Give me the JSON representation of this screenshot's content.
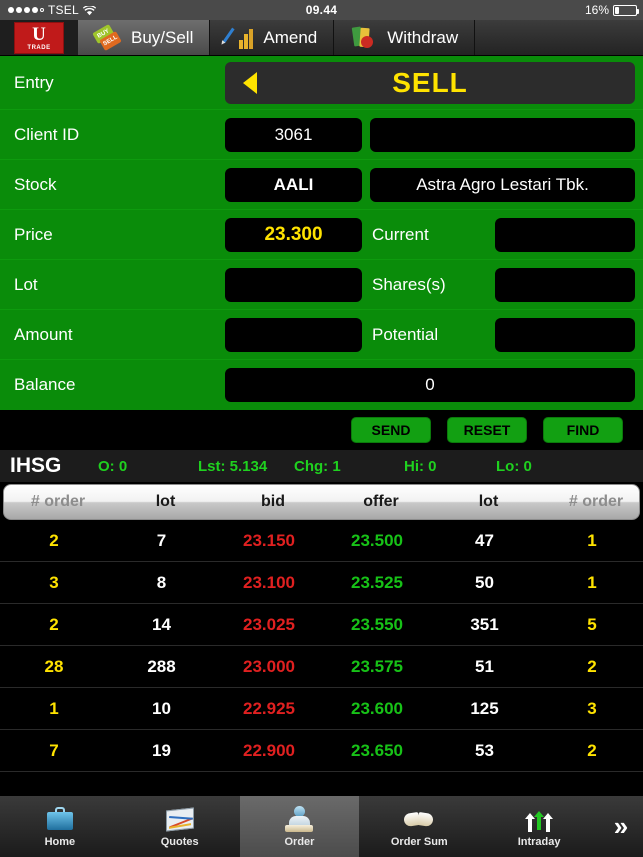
{
  "status_bar": {
    "carrier": "TSEL",
    "signal_dots_filled": 4,
    "signal_dots_total": 5,
    "wifi_icon": "wifi-icon",
    "time": "09.44",
    "battery_percent": "16%",
    "battery_level": 16
  },
  "brand": {
    "logo_letter": "U",
    "logo_word": "TRADE"
  },
  "top_tabs": [
    {
      "label": "Buy/Sell",
      "icon": "buy-sell-tags-icon",
      "active": true
    },
    {
      "label": "Amend",
      "icon": "amend-chart-pencil-icon",
      "active": false
    },
    {
      "label": "Withdraw",
      "icon": "withdraw-books-icon",
      "active": false
    }
  ],
  "entry_form": {
    "entry": {
      "label": "Entry",
      "arrow_icon": "caret-left-icon",
      "value": "SELL",
      "value_color": "#ffe300"
    },
    "client_id": {
      "label": "Client ID",
      "value": "3061",
      "secondary_value": ""
    },
    "stock": {
      "label": "Stock",
      "code": "AALI",
      "name": "Astra Agro Lestari Tbk."
    },
    "price": {
      "label": "Price",
      "value": "23.300",
      "value_color": "#ffe300",
      "current_label": "Current",
      "current_value": ""
    },
    "lot": {
      "label": "Lot",
      "value": "",
      "shares_label": "Shares(s)",
      "shares_value": ""
    },
    "amount": {
      "label": "Amount",
      "value": "",
      "potential_label": "Potential",
      "potential_value": ""
    },
    "balance": {
      "label": "Balance",
      "value": "0"
    }
  },
  "actions": [
    {
      "label": "SEND"
    },
    {
      "label": "RESET"
    },
    {
      "label": "FIND"
    }
  ],
  "index_bar": {
    "name": "IHSG",
    "open_label": "O: 0",
    "last_label": "Lst: 5.134",
    "change_label": "Chg: 1",
    "high_label": "Hi: 0",
    "low_label": "Lo: 0",
    "color": "#1fd11f"
  },
  "order_book": {
    "columns": [
      "# order",
      "lot",
      "bid",
      "offer",
      "lot",
      "# order"
    ],
    "rows": [
      {
        "bid_order": "2",
        "bid_lot": "7",
        "bid": "23.150",
        "offer": "23.500",
        "offer_lot": "47",
        "offer_order": "1"
      },
      {
        "bid_order": "3",
        "bid_lot": "8",
        "bid": "23.100",
        "offer": "23.525",
        "offer_lot": "50",
        "offer_order": "1"
      },
      {
        "bid_order": "2",
        "bid_lot": "14",
        "bid": "23.025",
        "offer": "23.550",
        "offer_lot": "351",
        "offer_order": "5"
      },
      {
        "bid_order": "28",
        "bid_lot": "288",
        "bid": "23.000",
        "offer": "23.575",
        "offer_lot": "51",
        "offer_order": "2"
      },
      {
        "bid_order": "1",
        "bid_lot": "10",
        "bid": "22.925",
        "offer": "23.600",
        "offer_lot": "125",
        "offer_order": "3"
      },
      {
        "bid_order": "7",
        "bid_lot": "19",
        "bid": "22.900",
        "offer": "23.650",
        "offer_lot": "53",
        "offer_order": "2"
      }
    ],
    "colors": {
      "order": "#ffe300",
      "lot": "#ffffff",
      "bid": "#e02020",
      "offer": "#17c217"
    }
  },
  "bottom_tabs": [
    {
      "label": "Home",
      "icon": "briefcase-icon",
      "active": false
    },
    {
      "label": "Quotes",
      "icon": "chart-thumbnail-icon",
      "active": false
    },
    {
      "label": "Order",
      "icon": "person-order-icon",
      "active": true
    },
    {
      "label": "Order Sum",
      "icon": "open-book-icon",
      "active": false
    },
    {
      "label": "Intraday",
      "icon": "up-arrows-icon",
      "active": false
    }
  ],
  "more_button": {
    "icon": "double-chevron-right-icon",
    "glyph": "»"
  },
  "theme": {
    "form_green": "#0a8c0a",
    "accent_yellow": "#ffe300",
    "bid_red": "#e02020",
    "offer_green": "#17c217",
    "brand_red": "#c01a1a"
  }
}
